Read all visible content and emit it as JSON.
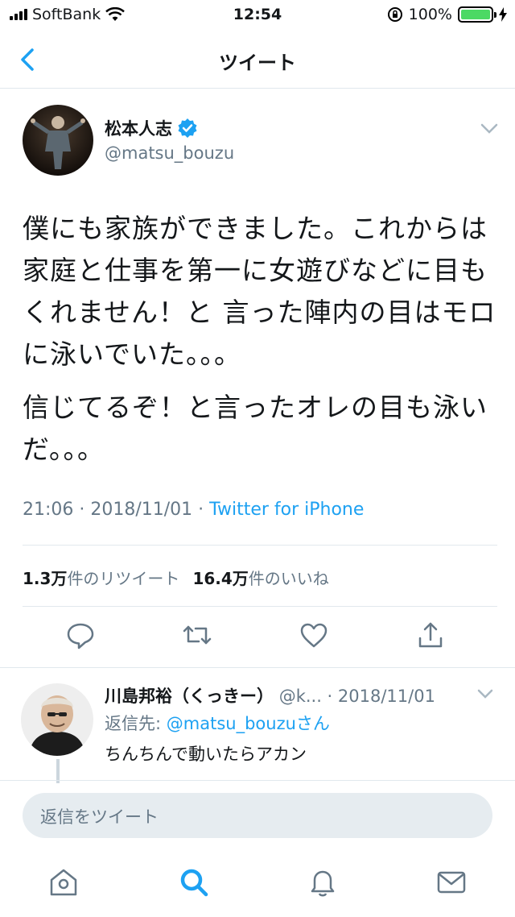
{
  "status_bar": {
    "carrier": "SoftBank",
    "time": "12:54",
    "battery": "100%",
    "battery_level": 1.0
  },
  "nav": {
    "title": "ツイート",
    "back_icon": "chevron-left-icon"
  },
  "tweet": {
    "author_name": "松本人志",
    "author_handle": "@matsu_bouzu",
    "verified": true,
    "text_paragraphs": [
      "僕にも家族ができました。これからは家庭と仕事を第一に女遊びなどに目もくれません！と 言った陣内の目はモロに泳いでいた。。。",
      "信じてるぞ！と言ったオレの目も泳いだ。。。"
    ],
    "timestamp": "21:06 · 2018/11/01 · ",
    "source": "Twitter for iPhone",
    "retweet_count": "1.3万",
    "retweet_label": "件のリツイート",
    "like_count": "16.4万",
    "like_label": "件のいいね"
  },
  "reply": {
    "name": "川島邦裕（くっきー）",
    "handle": "@k...",
    "date": " · 2018/11/01",
    "reply_to_prefix": "返信先: ",
    "reply_to_mention": "@matsu_bouzuさん",
    "text": "ちんちんで動いたらアカン"
  },
  "composer": {
    "placeholder": "返信をツイート"
  },
  "tabbar": {
    "items": [
      "home-icon",
      "search-icon",
      "notifications-icon",
      "messages-icon"
    ],
    "active": "search-icon"
  },
  "colors": {
    "accent": "#1da1f2",
    "secondary_text": "#657786",
    "battery": "#4cd964"
  }
}
